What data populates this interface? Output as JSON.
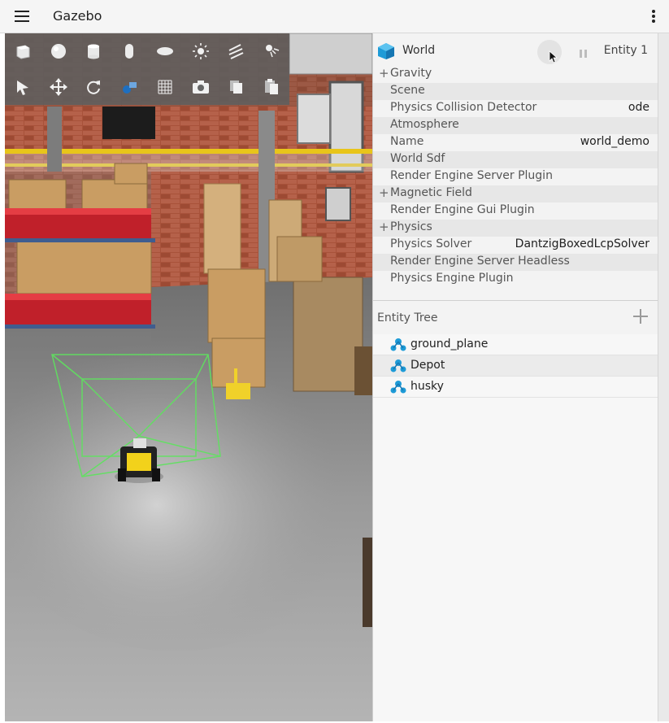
{
  "app": {
    "title": "Gazebo"
  },
  "toolbar_top": [
    "box-shape-icon",
    "sphere-shape-icon",
    "cylinder-shape-icon",
    "capsule-shape-icon",
    "ellipsoid-shape-icon",
    "point-light-icon",
    "directional-light-icon",
    "spot-light-icon"
  ],
  "toolbar_bottom": [
    "select-mode-icon",
    "translate-mode-icon",
    "rotate-mode-icon",
    "transform-control-icon",
    "grid-config-icon",
    "screenshot-icon",
    "copy-icon",
    "paste-icon"
  ],
  "component_inspector": {
    "title": "World",
    "entity_label": "Entity 1",
    "properties": [
      {
        "label": "Gravity",
        "value": "",
        "expandable": true
      },
      {
        "label": "Scene",
        "value": "",
        "expandable": false
      },
      {
        "label": "Physics Collision Detector",
        "value": "ode",
        "expandable": false
      },
      {
        "label": "Atmosphere",
        "value": "",
        "expandable": false
      },
      {
        "label": "Name",
        "value": "world_demo",
        "expandable": false
      },
      {
        "label": "World Sdf",
        "value": "",
        "expandable": false
      },
      {
        "label": "Render Engine Server Plugin",
        "value": "",
        "expandable": false
      },
      {
        "label": "Magnetic Field",
        "value": "",
        "expandable": true
      },
      {
        "label": "Render Engine Gui Plugin",
        "value": "",
        "expandable": false
      },
      {
        "label": "Physics",
        "value": "",
        "expandable": true
      },
      {
        "label": "Physics Solver",
        "value": "DantzigBoxedLcpSolver",
        "expandable": false
      },
      {
        "label": "Render Engine Server Headless",
        "value": "",
        "expandable": false
      },
      {
        "label": "Physics Engine Plugin",
        "value": "",
        "expandable": false
      }
    ]
  },
  "entity_tree": {
    "title": "Entity Tree",
    "items": [
      "ground_plane",
      "Depot",
      "husky"
    ]
  },
  "colors": {
    "accent": "#1e9bd7",
    "selection_box": "#5ee35e",
    "robot_yellow": "#f2d21b"
  }
}
